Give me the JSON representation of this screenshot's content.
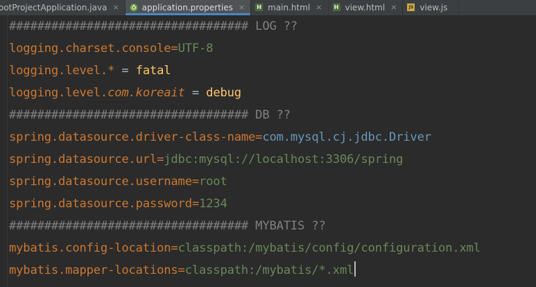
{
  "tabs": [
    {
      "label": "ootProjectApplication.java",
      "icon": "java-class-icon",
      "active": false,
      "close": "×"
    },
    {
      "label": "application.properties",
      "icon": "spring-properties-icon",
      "active": true,
      "close": "×"
    },
    {
      "label": "main.html",
      "icon": "html-file-icon",
      "active": false,
      "close": "×"
    },
    {
      "label": "view.html",
      "icon": "html-file-icon",
      "active": false,
      "close": "×"
    },
    {
      "label": "view.js",
      "icon": "js-file-icon",
      "active": false,
      "close": ""
    }
  ],
  "icons": {
    "html_letter": "H",
    "js_letter": "JS"
  },
  "colors": {
    "tabbar": "#3c3f41",
    "editor_bg": "#2b2b2b",
    "comment": "#808080",
    "key": "#cc7832",
    "value": "#6a8759",
    "class_value": "#6897bb",
    "level_value": "#ffc66d"
  },
  "editor": {
    "line1": {
      "text": "################################## LOG ??"
    },
    "line2": {
      "key": "logging.charset.console",
      "sep": "=",
      "value": "UTF-8"
    },
    "line3": {
      "key_a": "logging.level.",
      "key_b": "*",
      "sep": " = ",
      "value": "fatal"
    },
    "line4": {
      "key_a": "logging.level.",
      "key_b": "com.koreait",
      "sep": " = ",
      "value": "debug"
    },
    "line5": {
      "text": "################################## DB ??"
    },
    "line6": {
      "key": "spring.datasource.driver-class-name",
      "sep": "=",
      "value": "com.mysql.cj.jdbc.Driver"
    },
    "line7": {
      "key": "spring.datasource.url",
      "sep": "=",
      "value": "jdbc:mysql://localhost:3306/spring"
    },
    "line8": {
      "key": "spring.datasource.username",
      "sep": "=",
      "value": "root"
    },
    "line9": {
      "key": "spring.datasource.password",
      "sep": "=",
      "value": "1234"
    },
    "line10": {
      "text": "################################## MYBATIS ??"
    },
    "line11": {
      "key": "mybatis.config-location",
      "sep": "=",
      "value": "classpath:/mybatis/config/configuration.xml"
    },
    "line12": {
      "key": "mybatis.mapper-locations",
      "sep": "=",
      "value": "classpath:/mybatis/*.xml"
    }
  }
}
